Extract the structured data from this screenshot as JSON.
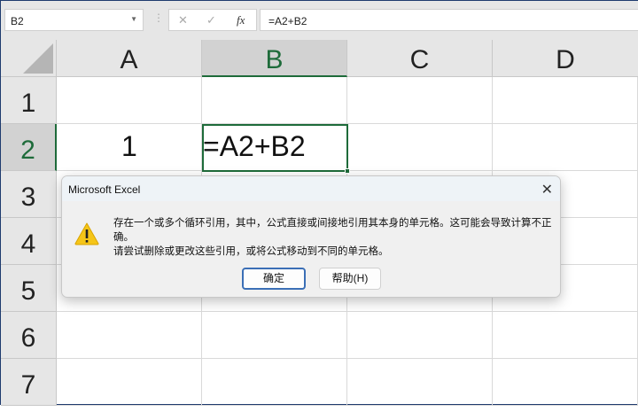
{
  "name_box": {
    "value": "B2"
  },
  "formula_bar": {
    "cancel_icon": "✕",
    "enter_icon": "✓",
    "fx_label": "fx",
    "value": "=A2+B2"
  },
  "columns": [
    "A",
    "B",
    "C",
    "D"
  ],
  "rows": [
    "1",
    "2",
    "3",
    "4",
    "5",
    "6",
    "7"
  ],
  "cells": {
    "A2": "1",
    "B2": "=A2+B2"
  },
  "dialog": {
    "title": "Microsoft Excel",
    "message1": "存在一个或多个循环引用，其中，公式直接或间接地引用其本身的单元格。这可能会导致计算不正确。",
    "message2": "请尝试删除或更改这些引用，或将公式移动到不同的单元格。",
    "ok_label": "确定",
    "help_label": "帮助(H)"
  },
  "colors": {
    "accent": "#1e6b3a",
    "warning": "#f5c518"
  }
}
